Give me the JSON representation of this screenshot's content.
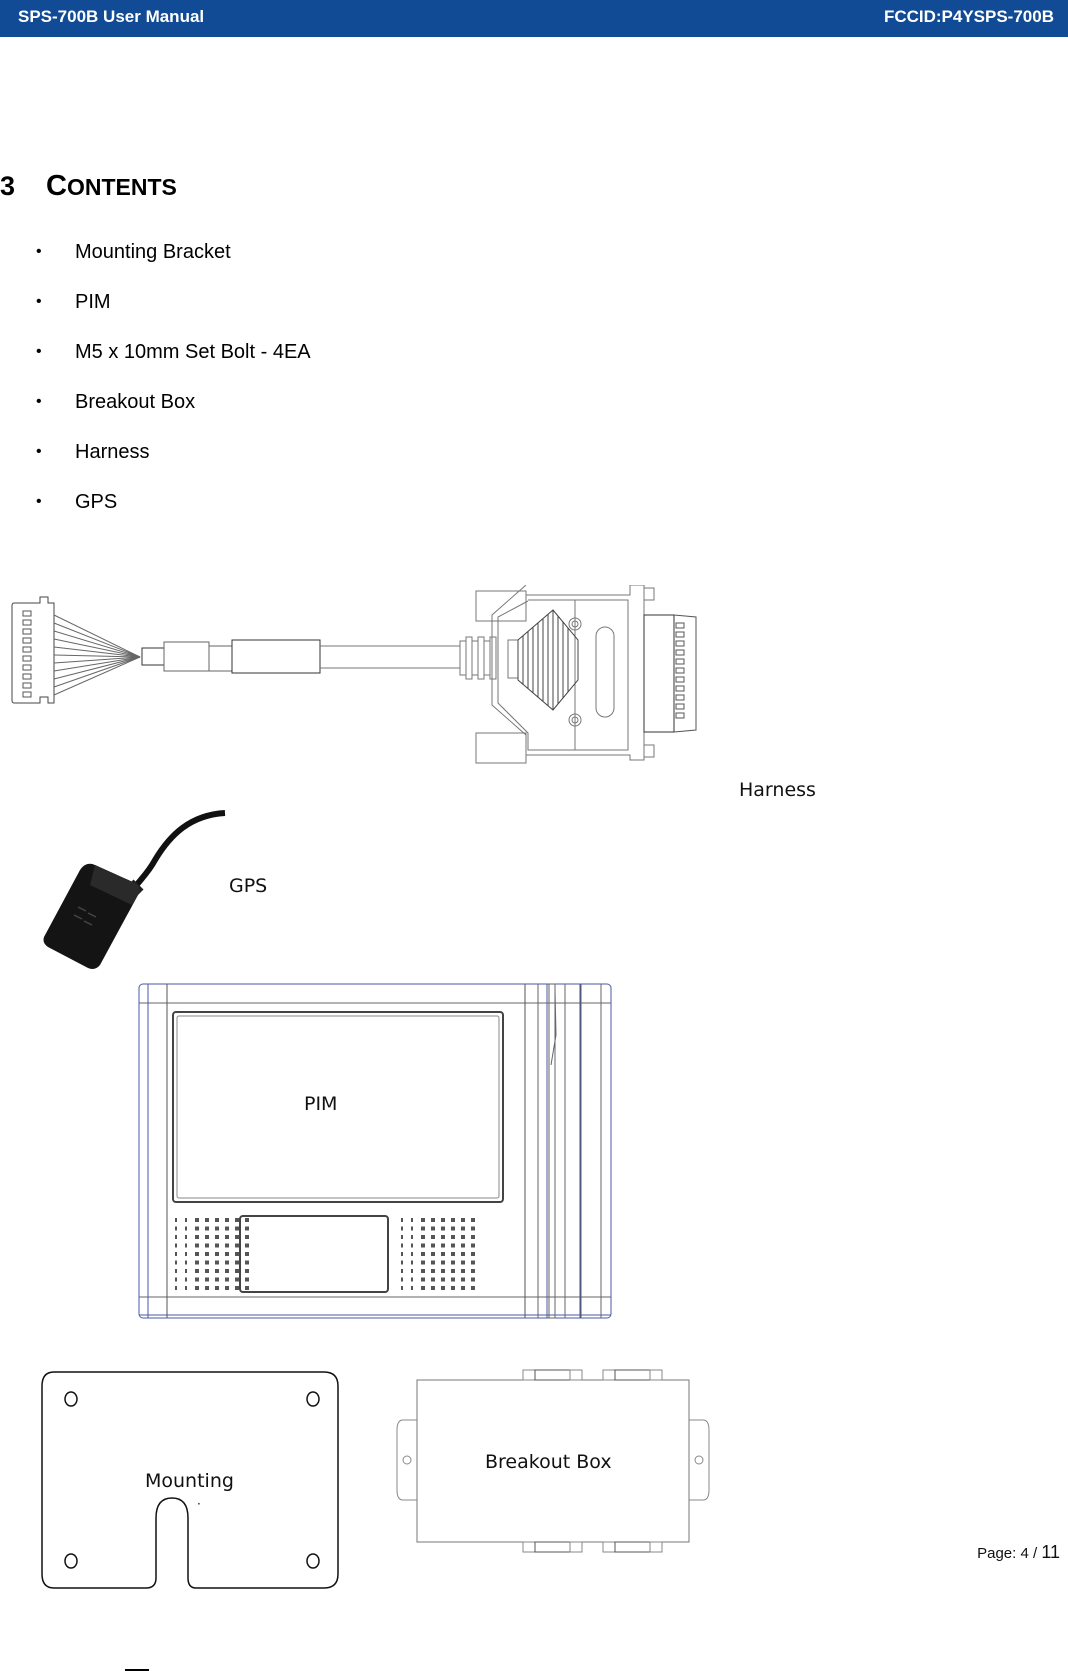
{
  "header": {
    "title": "SPS-700B User Manual",
    "fccid": "FCCID:P4YSPS-700B",
    "background_color": "#114a95",
    "text_color": "#ffffff"
  },
  "section": {
    "number": "3",
    "title_first": "C",
    "title_rest": "ONTENTS"
  },
  "contents": [
    {
      "bullet": "•",
      "label": "Mounting Bracket"
    },
    {
      "bullet": "•",
      "label": "PIM"
    },
    {
      "bullet": "•",
      "label": "M5 x 10mm Set Bolt - 4EA"
    },
    {
      "bullet": "•",
      "label": "Breakout Box"
    },
    {
      "bullet": "•",
      "label": "Harness"
    },
    {
      "bullet": "•",
      "label": "GPS"
    }
  ],
  "figures": {
    "harness_label": "Harness",
    "gps_label": "GPS",
    "pim_label": "PIM",
    "mounting_label": "Mounting",
    "mounting_sub": "·",
    "breakout_label": "Breakout Box"
  },
  "footer": {
    "page_prefix": "Page: 4 / ",
    "page_total": "11"
  }
}
